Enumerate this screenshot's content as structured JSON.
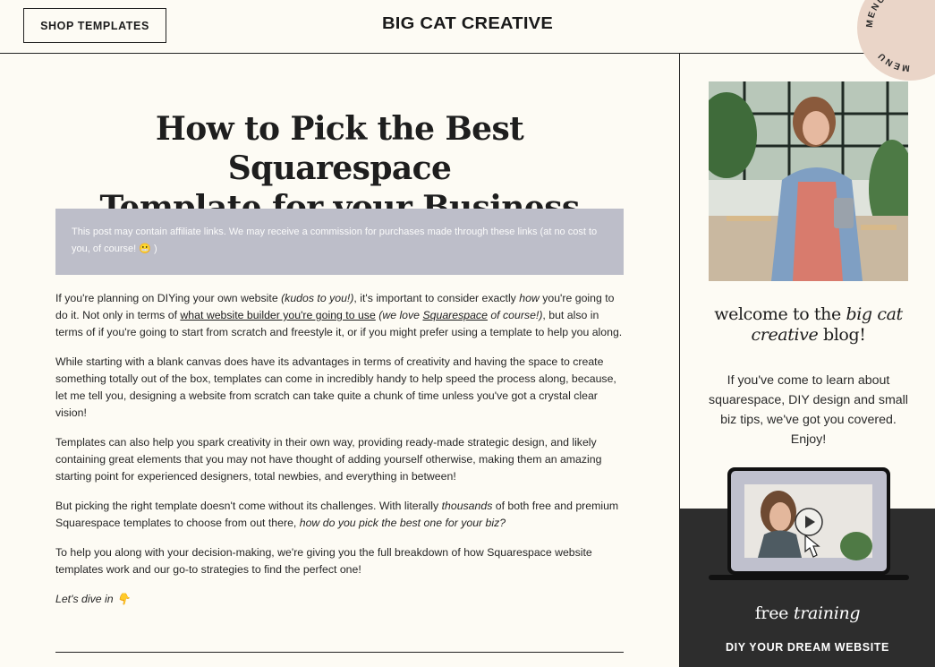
{
  "header": {
    "shop_button": "SHOP TEMPLATES",
    "logo": "BIG CAT CREATIVE",
    "menu_label": "MENU"
  },
  "article": {
    "title_line1": "How to Pick the Best Squarespace",
    "title_line2": "Template for your Business",
    "affiliate_notice": "This post may contain affiliate links. We may receive a commission for purchases made through these links (at no cost to you, of course! 😬 )",
    "p1": {
      "a": "If you're planning on DIYing your own website ",
      "b": "(kudos to you!)",
      "c": ", it's important to consider exactly ",
      "d": "how",
      "e": " you're going to do it. Not only in terms of ",
      "link1": "what website builder you're going to use",
      "f": " ",
      "g": "(we love ",
      "link2": "Squarespace",
      "h": " of course!)",
      "i": ", but also in terms of if you're going to start from scratch and freestyle it, or if you might prefer using a template to help you along."
    },
    "p2": "While starting with a blank canvas does have its advantages in terms of creativity and having the space to create something totally out of the box, templates can come in incredibly handy to help speed the process along, because, let me tell you, designing a website from scratch can take quite a chunk of time unless you've got a crystal clear vision!",
    "p3": "Templates can also help you spark creativity in their own way, providing ready-made strategic design, and likely containing great elements that you may not have thought of adding yourself otherwise, making them an amazing starting point for experienced designers, total newbies, and everything in between!",
    "p4": {
      "a": "But picking the right template doesn't come without its challenges. With literally ",
      "b": "thousands",
      "c": " of both free and premium Squarespace templates to choose from out there, ",
      "d": "how do you pick the best one for your biz?"
    },
    "p5": "To help you along with your decision-making, we're giving you the full breakdown of how Squarespace website templates work and our go-to strategies to find the perfect one!",
    "p6": "Let's dive in 👇"
  },
  "sidebar": {
    "welcome_a": "welcome to the ",
    "welcome_b": "big cat creative",
    "welcome_c": " blog!",
    "intro": "If you've come to learn about squarespace, DIY design and small biz tips, we've got you covered. Enjoy!",
    "free_a": "free ",
    "free_b": "training",
    "cta": "DIY YOUR DREAM WEBSITE"
  },
  "colors": {
    "background": "#fdfbf4",
    "affiliate_box": "#bdbec9",
    "menu_badge": "#ead5c8",
    "dark_panel": "#2d2d2d"
  }
}
